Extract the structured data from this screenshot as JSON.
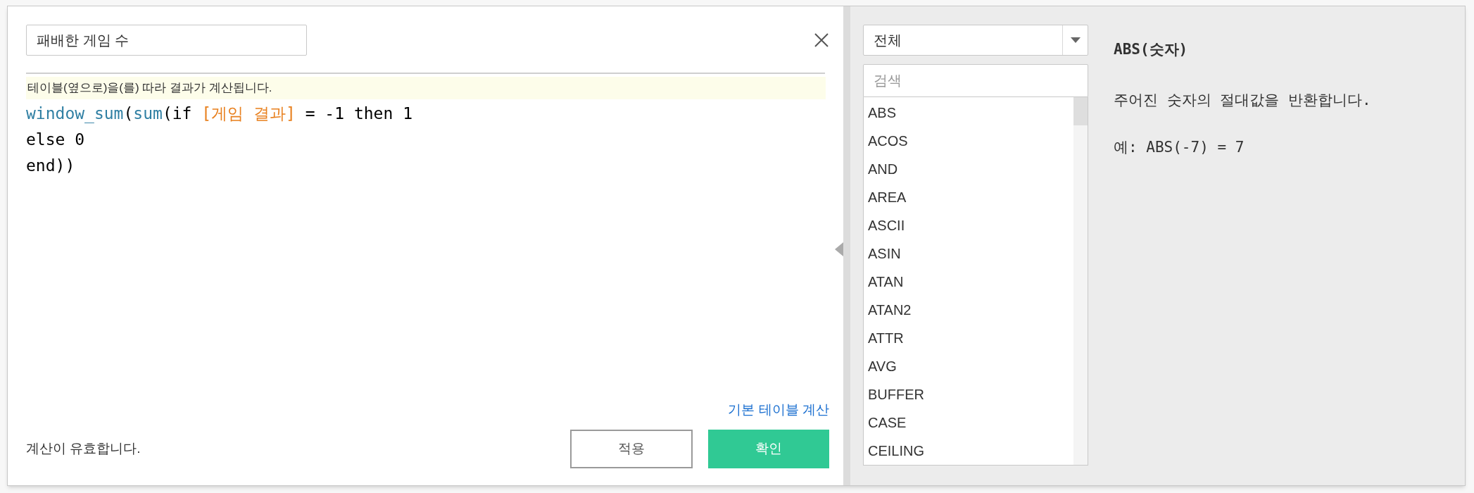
{
  "editor": {
    "name_field": "패배한 게임 수",
    "hint": "테이블(옆으로)을(를) 따라 결과가 계산됩니다.",
    "code_lines": [
      [
        {
          "kind": "function",
          "text": "window_sum"
        },
        {
          "kind": "plain",
          "text": "("
        },
        {
          "kind": "function",
          "text": "sum"
        },
        {
          "kind": "plain",
          "text": "(if "
        },
        {
          "kind": "field",
          "text": "[게임 결과]"
        },
        {
          "kind": "plain",
          "text": " = -1 then 1"
        }
      ],
      [
        {
          "kind": "plain",
          "text": "else 0"
        }
      ],
      [
        {
          "kind": "plain",
          "text": "end))"
        }
      ]
    ],
    "link": "기본 테이블 계산",
    "status": "계산이 유효합니다.",
    "buttons": [
      {
        "label": "적용",
        "kind": "secondary"
      },
      {
        "label": "확인",
        "kind": "primary"
      }
    ]
  },
  "functions": {
    "category": "전체",
    "search": {
      "placeholder": "검색"
    },
    "items": [
      {
        "label": "ABS"
      },
      {
        "label": "ACOS"
      },
      {
        "label": "AND"
      },
      {
        "label": "AREA"
      },
      {
        "label": "ASCII"
      },
      {
        "label": "ASIN"
      },
      {
        "label": "ATAN"
      },
      {
        "label": "ATAN2"
      },
      {
        "label": "ATTR"
      },
      {
        "label": "AVG"
      },
      {
        "label": "BUFFER"
      },
      {
        "label": "CASE"
      },
      {
        "label": "CEILING"
      }
    ]
  },
  "help": {
    "title": "ABS(숫자)",
    "description": "주어진 숫자의 절대값을 반환합니다.",
    "example": "예: ABS(-7) = 7"
  }
}
